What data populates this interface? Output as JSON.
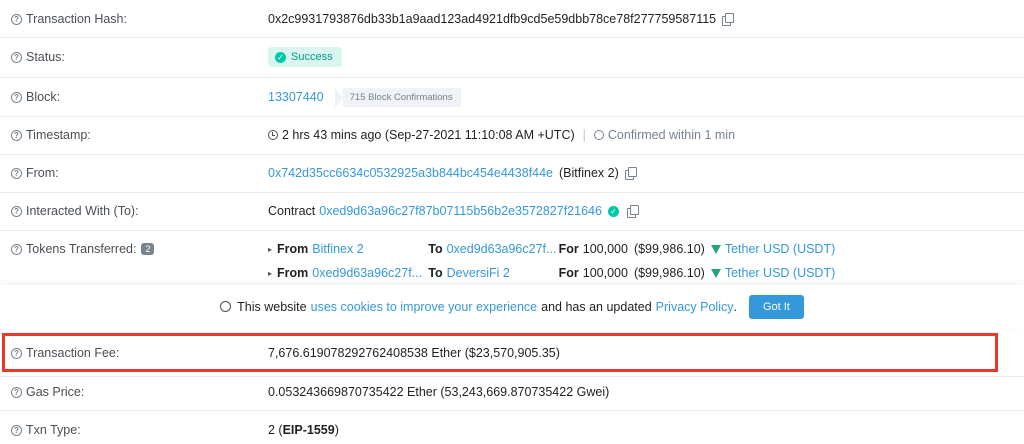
{
  "rows": {
    "tx_hash": {
      "label": "Transaction Hash:",
      "value": "0x2c9931793876db33b1a9aad123ad4921dfb9cd5e59dbb78ce78f277759587115"
    },
    "status": {
      "label": "Status:",
      "value": "Success"
    },
    "block": {
      "label": "Block:",
      "number": "13307440",
      "confirmations": "715 Block Confirmations"
    },
    "timestamp": {
      "label": "Timestamp:",
      "value": "2 hrs 43 mins ago (Sep-27-2021 11:10:08 AM +UTC)",
      "separator": "|",
      "confirmed": "Confirmed within 1 min"
    },
    "from": {
      "label": "From:",
      "address": "0x742d35cc6634c0532925a3b844bc454e4438f44e",
      "name": "(Bitfinex 2)"
    },
    "to": {
      "label": "Interacted With (To):",
      "prefix": "Contract",
      "address": "0xed9d63a96c27f87b07115b56b2e3572827f21646"
    },
    "tokens": {
      "label": "Tokens Transferred:",
      "count": "2",
      "transfers": [
        {
          "from_word": "From",
          "from": "Bitfinex 2",
          "to_word": "To",
          "to": "0xed9d63a96c27f...",
          "for_word": "For",
          "amount": "100,000",
          "usd": "($99,986.10)",
          "token": "Tether USD (USDT)"
        },
        {
          "from_word": "From",
          "from": "0xed9d63a96c27f...",
          "to_word": "To",
          "to": "DeversiFi 2",
          "for_word": "For",
          "amount": "100,000",
          "usd": "($99,986.10)",
          "token": "Tether USD (USDT)"
        }
      ]
    },
    "fee": {
      "label": "Transaction Fee:",
      "value": "7,676.619078292762408538 Ether ($23,570,905.35)"
    },
    "gas_price": {
      "label": "Gas Price:",
      "value": "0.053243669870735422 Ether (53,243,669.870735422 Gwei)"
    },
    "txn_type": {
      "label": "Txn Type:",
      "value_prefix": "2 (",
      "value_bold": "EIP-1559",
      "value_suffix": ")"
    }
  },
  "cookie": {
    "text1": "This website",
    "link1": "uses cookies to improve your experience",
    "text2": "and has an updated",
    "link2": "Privacy Policy",
    "text3": ".",
    "button": "Got It"
  },
  "colors": {
    "link": "#3498db",
    "success_bg": "#daf5ef",
    "success_text": "#00a186",
    "highlight_border": "#e9372b"
  },
  "icons": {
    "help": "question-circle-icon",
    "copy": "copy-icon",
    "check": "check-circle-icon",
    "clock": "clock-icon",
    "timer": "timer-icon",
    "tether": "tether-icon",
    "cookie": "cookie-icon"
  }
}
